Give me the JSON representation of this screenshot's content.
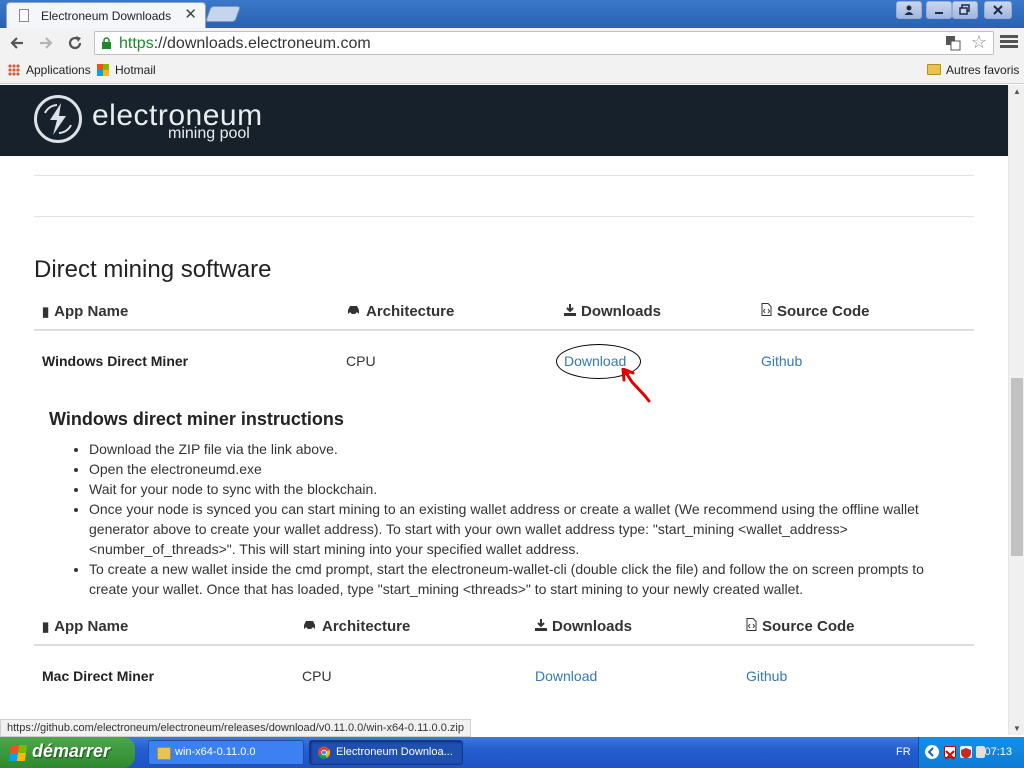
{
  "browser": {
    "tab_title": "Electroneum Downloads",
    "tab_close": "✕",
    "url_scheme": "https",
    "url_rest": "://downloads.electroneum.com",
    "bookmarks": [
      "Applications",
      "Hotmail"
    ],
    "other_bookmarks": "Autres favoris",
    "status_url": "https://github.com/electroneum/electroneum/releases/download/v0.11.0.0/win-x64-0.11.0.0.zip"
  },
  "site": {
    "logo_name": "electroneum",
    "logo_sub": "mining pool"
  },
  "section": {
    "title": "Direct mining software"
  },
  "table1": {
    "headers": [
      "App Name",
      "Architecture",
      "Downloads",
      "Source Code"
    ],
    "row": [
      "Windows Direct Miner",
      "CPU",
      "Download",
      "Github"
    ]
  },
  "instructions": {
    "title": "Windows direct miner instructions",
    "items": [
      "Download the ZIP file via the link above.",
      "Open the electroneumd.exe",
      "Wait for your node to sync with the blockchain.",
      "Once your node is synced you can start mining to an existing wallet address or create a wallet (We recommend using the offline wallet generator above to create your wallet address). To start with your own wallet address type: \"start_mining <wallet_address> <number_of_threads>\". This will start mining into your specified wallet address.",
      "To create a new wallet inside the cmd prompt, start the electroneum-wallet-cli (double click the file) and follow the on screen prompts to create your wallet. Once that has loaded, type \"start_mining <threads>\" to start mining to your newly created wallet."
    ]
  },
  "table2": {
    "headers": [
      "App Name",
      "Architecture",
      "Downloads",
      "Source Code"
    ],
    "row": [
      "Mac Direct Miner",
      "CPU",
      "Download",
      "Github"
    ]
  },
  "taskbar": {
    "start_label": "démarrer",
    "tasks": [
      "win-x64-0.11.0.0",
      "Electroneum Downloa..."
    ],
    "language": "FR",
    "clock": "07:13"
  },
  "colors": {
    "header_bg": "#17212b",
    "link": "#337ab7",
    "annotation_arrow": "#e00000"
  }
}
